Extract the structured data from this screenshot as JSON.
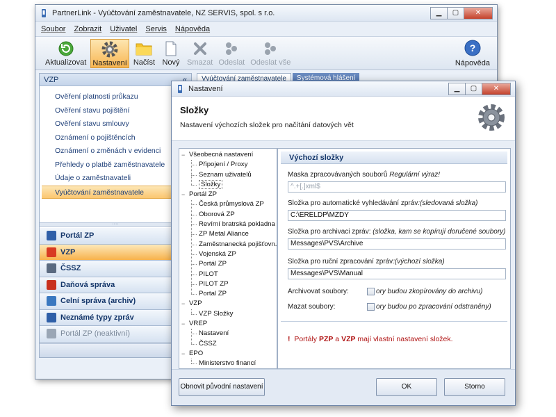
{
  "main": {
    "title": "PartnerLink - Vyúčtování zaměstnavatele, NZ SERVIS, spol. s r.o.",
    "menu": [
      "Soubor",
      "Zobrazit",
      "Uživatel",
      "Servis",
      "Nápověda"
    ],
    "toolbar": [
      {
        "label": "Aktualizovat",
        "icon": "refresh-icon",
        "state": "normal"
      },
      {
        "label": "Nastavení",
        "icon": "gear-icon",
        "state": "active"
      },
      {
        "label": "Načíst",
        "icon": "folder-icon",
        "state": "normal"
      },
      {
        "label": "Nový",
        "icon": "new-document-icon",
        "state": "normal"
      },
      {
        "label": "Smazat",
        "icon": "delete-icon",
        "state": "disabled"
      },
      {
        "label": "Odeslat",
        "icon": "send-icon",
        "state": "disabled"
      },
      {
        "label": "Odeslat vše",
        "icon": "send-all-icon",
        "state": "disabled"
      }
    ],
    "help_label": "Nápověda",
    "sidebar": {
      "header": "VZP",
      "collapse": "«",
      "items": [
        "Ověření platnosti průkazu",
        "Ověření stavu pojištění",
        "Ověření stavu smlouvy",
        "Oznámení o pojištěncích",
        "Oznámení o změnách v evidenci",
        "Přehledy o platbě zaměstnavatele",
        "Údaje o zaměstnavateli",
        "Vyúčtování zaměstnavatele"
      ],
      "selected_item": 7,
      "nav": [
        {
          "label": "Portál ZP",
          "color": "#2f5fa8"
        },
        {
          "label": "VZP",
          "color": "#d83a22"
        },
        {
          "label": "ČSSZ",
          "color": "#5a6a80"
        },
        {
          "label": "Daňová správa",
          "color": "#c8301e"
        },
        {
          "label": "Celní správa (archiv)",
          "color": "#3a78c0"
        },
        {
          "label": "Neznámé typy zpráv",
          "color": "#2f5fa8"
        },
        {
          "label": "Portál ZP (neaktivní)",
          "color": "#9aa6b5"
        }
      ],
      "selected_nav": 1,
      "footer_chevron": "⌄"
    },
    "tabs": [
      "Vyúčtování zaměstnavatele",
      "Systémová hlášení"
    ]
  },
  "dialog": {
    "title": "Nastavení",
    "heading": "Složky",
    "subheading": "Nastavení výchozích složek pro načítání datových vět",
    "tree": [
      {
        "label": "Všeobecná nastavení",
        "level": 0
      },
      {
        "label": "Připojení / Proxy",
        "level": 1
      },
      {
        "label": "Seznam uživatelů",
        "level": 1
      },
      {
        "label": "Složky",
        "level": 1,
        "selected": true
      },
      {
        "label": "Portál ZP",
        "level": 0
      },
      {
        "label": "Česká průmyslová ZP",
        "level": 1
      },
      {
        "label": "Oborová ZP",
        "level": 1
      },
      {
        "label": "Revírní bratrská pokladna",
        "level": 1
      },
      {
        "label": "ZP Metal Aliance",
        "level": 1
      },
      {
        "label": "Zaměstnanecká pojišťovn...",
        "level": 1
      },
      {
        "label": "Vojenská ZP",
        "level": 1
      },
      {
        "label": "Portál ZP",
        "level": 1
      },
      {
        "label": "PILOT",
        "level": 1
      },
      {
        "label": "PILOT ZP",
        "level": 1
      },
      {
        "label": "Portal ZP",
        "level": 1
      },
      {
        "label": "VZP",
        "level": 0
      },
      {
        "label": "VZP Složky",
        "level": 1
      },
      {
        "label": "VREP",
        "level": 0
      },
      {
        "label": "Nastavení",
        "level": 1
      },
      {
        "label": "ČSSZ",
        "level": 1
      },
      {
        "label": "EPO",
        "level": 0
      },
      {
        "label": "Ministerstvo financí",
        "level": 1
      }
    ],
    "panel": {
      "title": "Výchozí složky",
      "mask_label": "Maska zpracovávaných souborů",
      "mask_label_italic": " Regulární výraz!",
      "mask_placeholder": "^.+[.]xml$",
      "auto_label": "Složka pro automatické vyhledávání zpráv",
      "auto_label_italic": ":(sledovaná složka)",
      "auto_value": "C:\\ERELDP\\MZDY",
      "archive_label": "Složka pro archivaci zpráv:",
      "archive_label_italic": " (složka, kam se kopírují doručené soubory)",
      "archive_value": "Messages\\PVS\\Archive",
      "manual_label": "Složka pro ruční zpracování zpráv",
      "manual_label_italic": ":(výchozí složka)",
      "manual_value": "Messages\\PVS\\Manual",
      "archive_files_label": "Archivovat soubory:",
      "archive_files_text": "ory budou zkopírovány do archivu)",
      "delete_files_label": "Mazat soubory:",
      "delete_files_text": "ory budou po zpracování odstraněny)",
      "note_mark": "!",
      "note_pre": "Portály ",
      "note_b1": "PZP",
      "note_mid": " a ",
      "note_b2": "VZP",
      "note_post": " mají vlastní nastavení složek."
    },
    "buttons": {
      "restore": "Obnovit původní nastavení",
      "ok": "OK",
      "cancel": "Storno"
    }
  }
}
